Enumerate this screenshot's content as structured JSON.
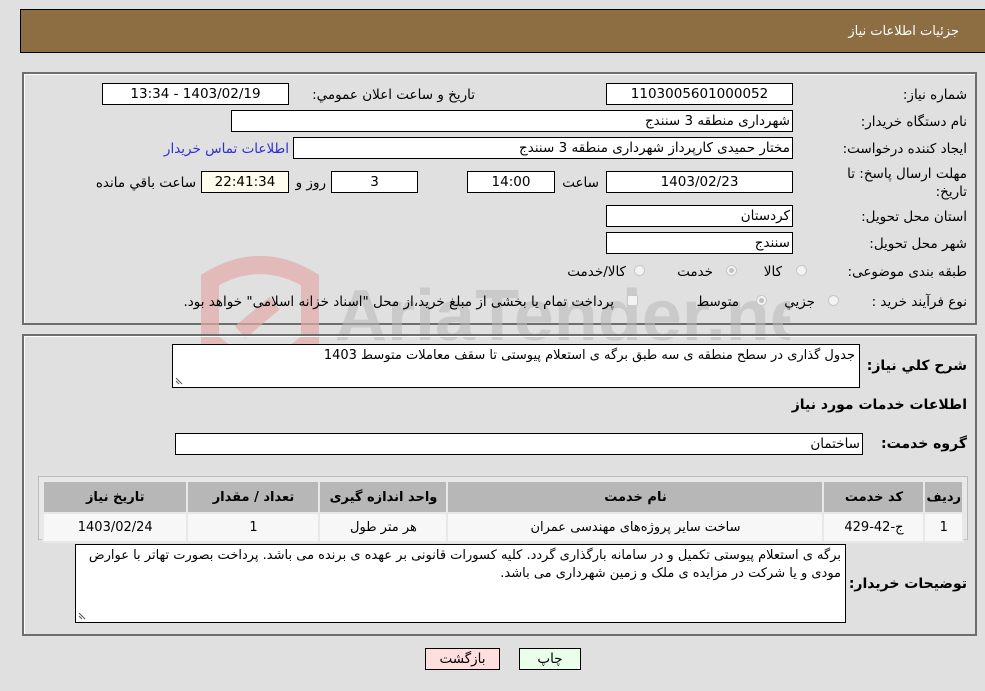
{
  "header": {
    "title": "جزئیات اطلاعات نیاز"
  },
  "form": {
    "need_number": {
      "label": "شماره نیاز:",
      "value": "1103005601000052"
    },
    "announce_datetime": {
      "label": "تاریخ و ساعت اعلان عمومي:",
      "value": "1403/02/19 - 13:34"
    },
    "buyer_org": {
      "label": "نام دستگاه خريدار:",
      "value": "شهرداری منطقه 3 سنندج"
    },
    "requester": {
      "label": "ایجاد کننده درخواست:",
      "value": "مختار حمیدی کارپرداز شهرداری منطقه 3 سنندج"
    },
    "buyer_contact_link": "اطلاعات تماس خریدار",
    "deadline": {
      "label": "مهلت ارسال پاسخ: تا تاریخ:",
      "date": "1403/02/23",
      "time_label": "ساعت",
      "time": "14:00",
      "days": "3",
      "days_label": "روز و",
      "remaining": "22:41:34",
      "remaining_label": "ساعت باقي مانده"
    },
    "province": {
      "label": "استان محل تحویل:",
      "value": "کردستان"
    },
    "city": {
      "label": "شهر محل تحویل:",
      "value": "سنندج"
    },
    "category": {
      "label": "طبقه بندی موضوعی:",
      "options": [
        "کالا",
        "خدمت",
        "کالا/خدمت"
      ],
      "selected": "خدمت"
    },
    "purchase_type": {
      "label": "نوع فرآیند خرید :",
      "options": [
        "جزيي",
        "متوسط"
      ],
      "selected": "متوسط",
      "treasury_note": "پرداخت تمام یا بخشی از مبلغ خرید،از محل \"اسناد خزانه اسلامی\" خواهد بود."
    }
  },
  "details": {
    "summary_label": "شرح كلي نياز:",
    "summary": "جدول گذاری در سطح منطقه ی سه طبق برگه ی استعلام پیوستی تا سقف معاملات متوسط 1403",
    "services_heading": "اطلاعات خدمات مورد نیاز",
    "service_group_label": "گروه خدمت:",
    "service_group": "ساختمان",
    "table": {
      "headers": [
        "ردیف",
        "کد خدمت",
        "نام خدمت",
        "واحد اندازه گیری",
        "تعداد / مقدار",
        "تاریخ نیاز"
      ],
      "rows": [
        [
          "1",
          "ج-42-429",
          "ساخت سایر پروژه‌های مهندسی عمران",
          "هر متر طول",
          "1",
          "1403/02/24"
        ]
      ]
    },
    "buyer_notes_label": "توضیحات خریدار:",
    "buyer_notes": "برگه ی استعلام پیوستی تکمیل و در سامانه بارگذاری گردد. کلیه کسورات قانونی بر عهده ی برنده می باشد. پرداخت بصورت تهاتر با عوارض مودی و یا شرکت در مزایده ی ملک و زمین شهرداری می باشد."
  },
  "buttons": {
    "print": "چاپ",
    "back": "بازگشت"
  },
  "watermark": {
    "text": "AriaTender.neT"
  }
}
